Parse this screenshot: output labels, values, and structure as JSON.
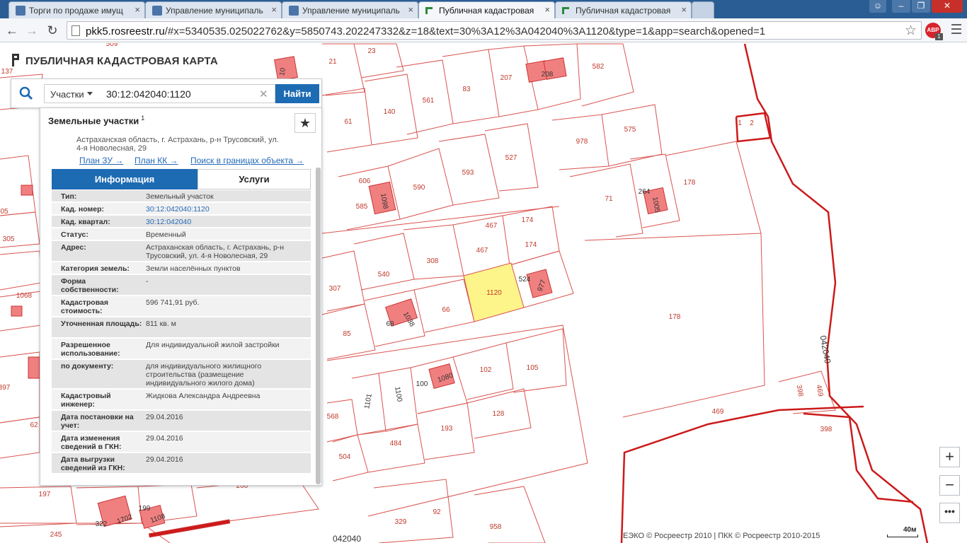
{
  "browser": {
    "tabs": [
      {
        "label": "Торги по продаже имущ",
        "active": false
      },
      {
        "label": "Управление муниципаль",
        "active": false
      },
      {
        "label": "Управление муниципаль",
        "active": false
      },
      {
        "label": "Публичная кадастровая",
        "active": true
      },
      {
        "label": "Публичная кадастровая",
        "active": false
      }
    ],
    "url_host": "pkk5.rosreestr.ru",
    "url_rest": "/#x=5340535.025022762&y=5850743.202247332&z=18&text=30%3A12%3A042040%3A1120&type=1&app=search&opened=1",
    "abp_label": "ABP",
    "abp_badge": "1"
  },
  "site": {
    "title": "ПУБЛИЧНАЯ КАДАСТРОВАЯ КАРТА"
  },
  "search": {
    "type_label": "Участки",
    "query": "30:12:042040:1120",
    "button_label": "Найти"
  },
  "panel": {
    "title": "Земельные участки",
    "count": "1",
    "address": "Астраханская область, г. Астрахань, р-н Трусовский, ул. 4-я Новолесная, 29",
    "links": [
      "План ЗУ →",
      "План КК →",
      "Поиск в границах объекта →"
    ],
    "tabs": [
      "Информация",
      "Услуги"
    ],
    "attributes": [
      {
        "key": "Тип:",
        "value": "Земельный участок"
      },
      {
        "key": "Кад. номер:",
        "value": "30:12:042040:1120"
      },
      {
        "key": "Кад. квартал:",
        "value": "30:12:042040"
      },
      {
        "key": "Статус:",
        "value": "Временный"
      },
      {
        "key": "Адрес:",
        "value": "Астраханская область, г. Астрахань, р-н Трусовский, ул. 4-я Новолесная, 29"
      },
      {
        "key": "Категория земель:",
        "value": "Земли населённых пунктов"
      },
      {
        "key": "Форма собственности:",
        "value": "-"
      },
      {
        "key": "Кадастровая стоимость:",
        "value": "596 741,91 руб."
      },
      {
        "key": "Уточненная площадь:",
        "value": "811 кв. м"
      },
      {
        "key": "Разрешенное использование:",
        "value": "Для индивидуальной жилой застройки"
      },
      {
        "key": "по документу:",
        "value": "для индивидуального жилищного строительства (размещение индивидуального жилого дома)"
      },
      {
        "key": "Кадастровый инженер:",
        "value": "Жидкова Александра Андреевна"
      },
      {
        "key": "Дата постановки на учет:",
        "value": "29.04.2016"
      },
      {
        "key": "Дата изменения сведений в ГКН:",
        "value": "29.04.2016"
      },
      {
        "key": "Дата выгрузки сведений из ГКН:",
        "value": "29.04.2016"
      }
    ]
  },
  "map": {
    "parcel_labels": [
      "509",
      "23",
      "21",
      "582",
      "208",
      "207",
      "83",
      "561",
      "140",
      "61",
      "1",
      "2",
      "575",
      "978",
      "527",
      "593",
      "590",
      "606",
      "585",
      "1098",
      "178",
      "71",
      "264",
      "1005",
      "467",
      "174",
      "174",
      "467",
      "308",
      "540",
      "307",
      "1120",
      "524",
      "977",
      "66",
      "68",
      "1038",
      "85",
      "178",
      "102",
      "105",
      "100",
      "1080",
      "1101",
      "1100",
      "568",
      "193",
      "128",
      "484",
      "504",
      "469",
      "398",
      "469",
      "398",
      "042040",
      "042040",
      "197",
      "1702",
      "322",
      "199",
      "1108",
      "245",
      "200",
      "329",
      "92",
      "958",
      "305",
      "1068",
      "397",
      "62",
      "137"
    ],
    "selected_parcel": "1120",
    "quarter_label": "042040",
    "colors": {
      "parcel_line": "#d9534f",
      "quarter_line": "#cc1a1a",
      "building": "#f08080",
      "selected": "#fdf48a"
    }
  },
  "controls": {
    "zoom_in": "+",
    "zoom_out": "−",
    "more": "•••",
    "copyright": "ЕЭКО © Росреестр 2010 | ПКК © Росреестр 2010-2015",
    "scale": "40м"
  }
}
